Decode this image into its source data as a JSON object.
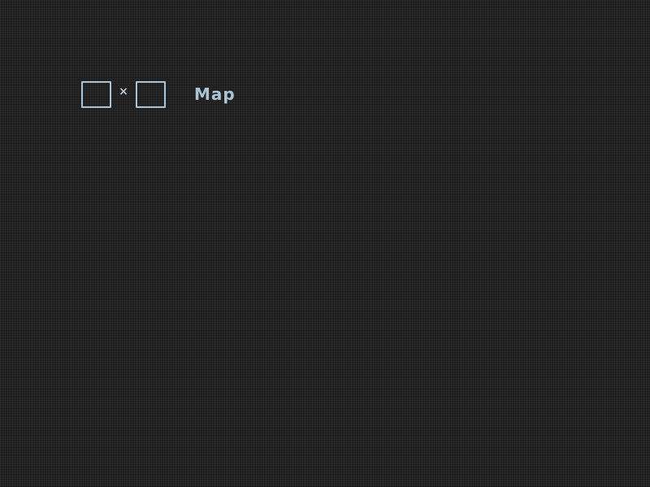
{
  "map_form": {
    "width_input": {
      "value": "",
      "placeholder": ""
    },
    "separator": "×",
    "height_input": {
      "value": "",
      "placeholder": ""
    },
    "map_button_label": "Map"
  },
  "colors": {
    "background": "#222222",
    "accent": "#a9c4d6"
  }
}
